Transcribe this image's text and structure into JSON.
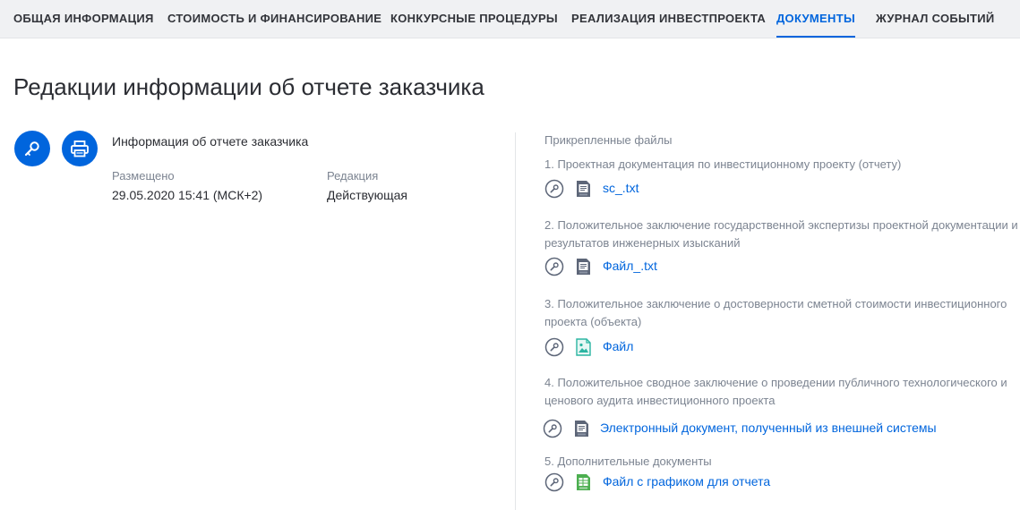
{
  "tabs": [
    {
      "label": "ОБЩАЯ ИНФОРМАЦИЯ",
      "active": false
    },
    {
      "label": "СТОИМОСТЬ И ФИНАНСИРОВАНИЕ",
      "active": false
    },
    {
      "label": "КОНКУРСНЫЕ ПРОЦЕДУРЫ",
      "active": false
    },
    {
      "label": "РЕАЛИЗАЦИЯ ИНВЕСТПРОЕКТА",
      "active": false
    },
    {
      "label": "ДОКУМЕНТЫ",
      "active": true
    },
    {
      "label": "ЖУРНАЛ СОБЫТИЙ",
      "active": false
    }
  ],
  "page_title": "Редакции информации об отчете заказчика",
  "info": {
    "title": "Информация об отчете заказчика",
    "placed_label": "Размещено",
    "placed_value": "29.05.2020 15:41 (МСК+2)",
    "edition_label": "Редакция",
    "edition_value": "Действующая"
  },
  "files": {
    "heading": "Прикрепленные файлы",
    "sections": [
      {
        "title": "1. Проектная документация по инвестиционному проекту (отчету)",
        "file": {
          "name": "sc_.txt",
          "icon": "txt-file-icon"
        }
      },
      {
        "title": "2. Положительное заключение государственной экспертизы проектной документации и результатов инженерных изысканий",
        "file": {
          "name": "Файл_.txt",
          "icon": "txt-file-icon"
        }
      },
      {
        "title": "3. Положительное заключение о достоверности сметной стоимости инвестиционного проекта (объекта)",
        "file": {
          "name": "Файл",
          "icon": "image-file-icon"
        }
      },
      {
        "title": "4. Положительное сводное заключение о проведении публичного технологического и ценового аудита инвестиционного проекта",
        "file": {
          "name": "Электронный документ, полученный из внешней системы",
          "icon": "txt-file-icon"
        }
      },
      {
        "title": "5. Дополнительные документы",
        "file": {
          "name": "Файл с графиком для отчета",
          "icon": "spreadsheet-file-icon"
        }
      }
    ]
  },
  "colors": {
    "accent": "#0065dd",
    "muted_text": "#7c8491",
    "icon_gray": "#5d6678",
    "image_file_teal": "#2bb5a2",
    "spreadsheet_green": "#4caf50"
  }
}
